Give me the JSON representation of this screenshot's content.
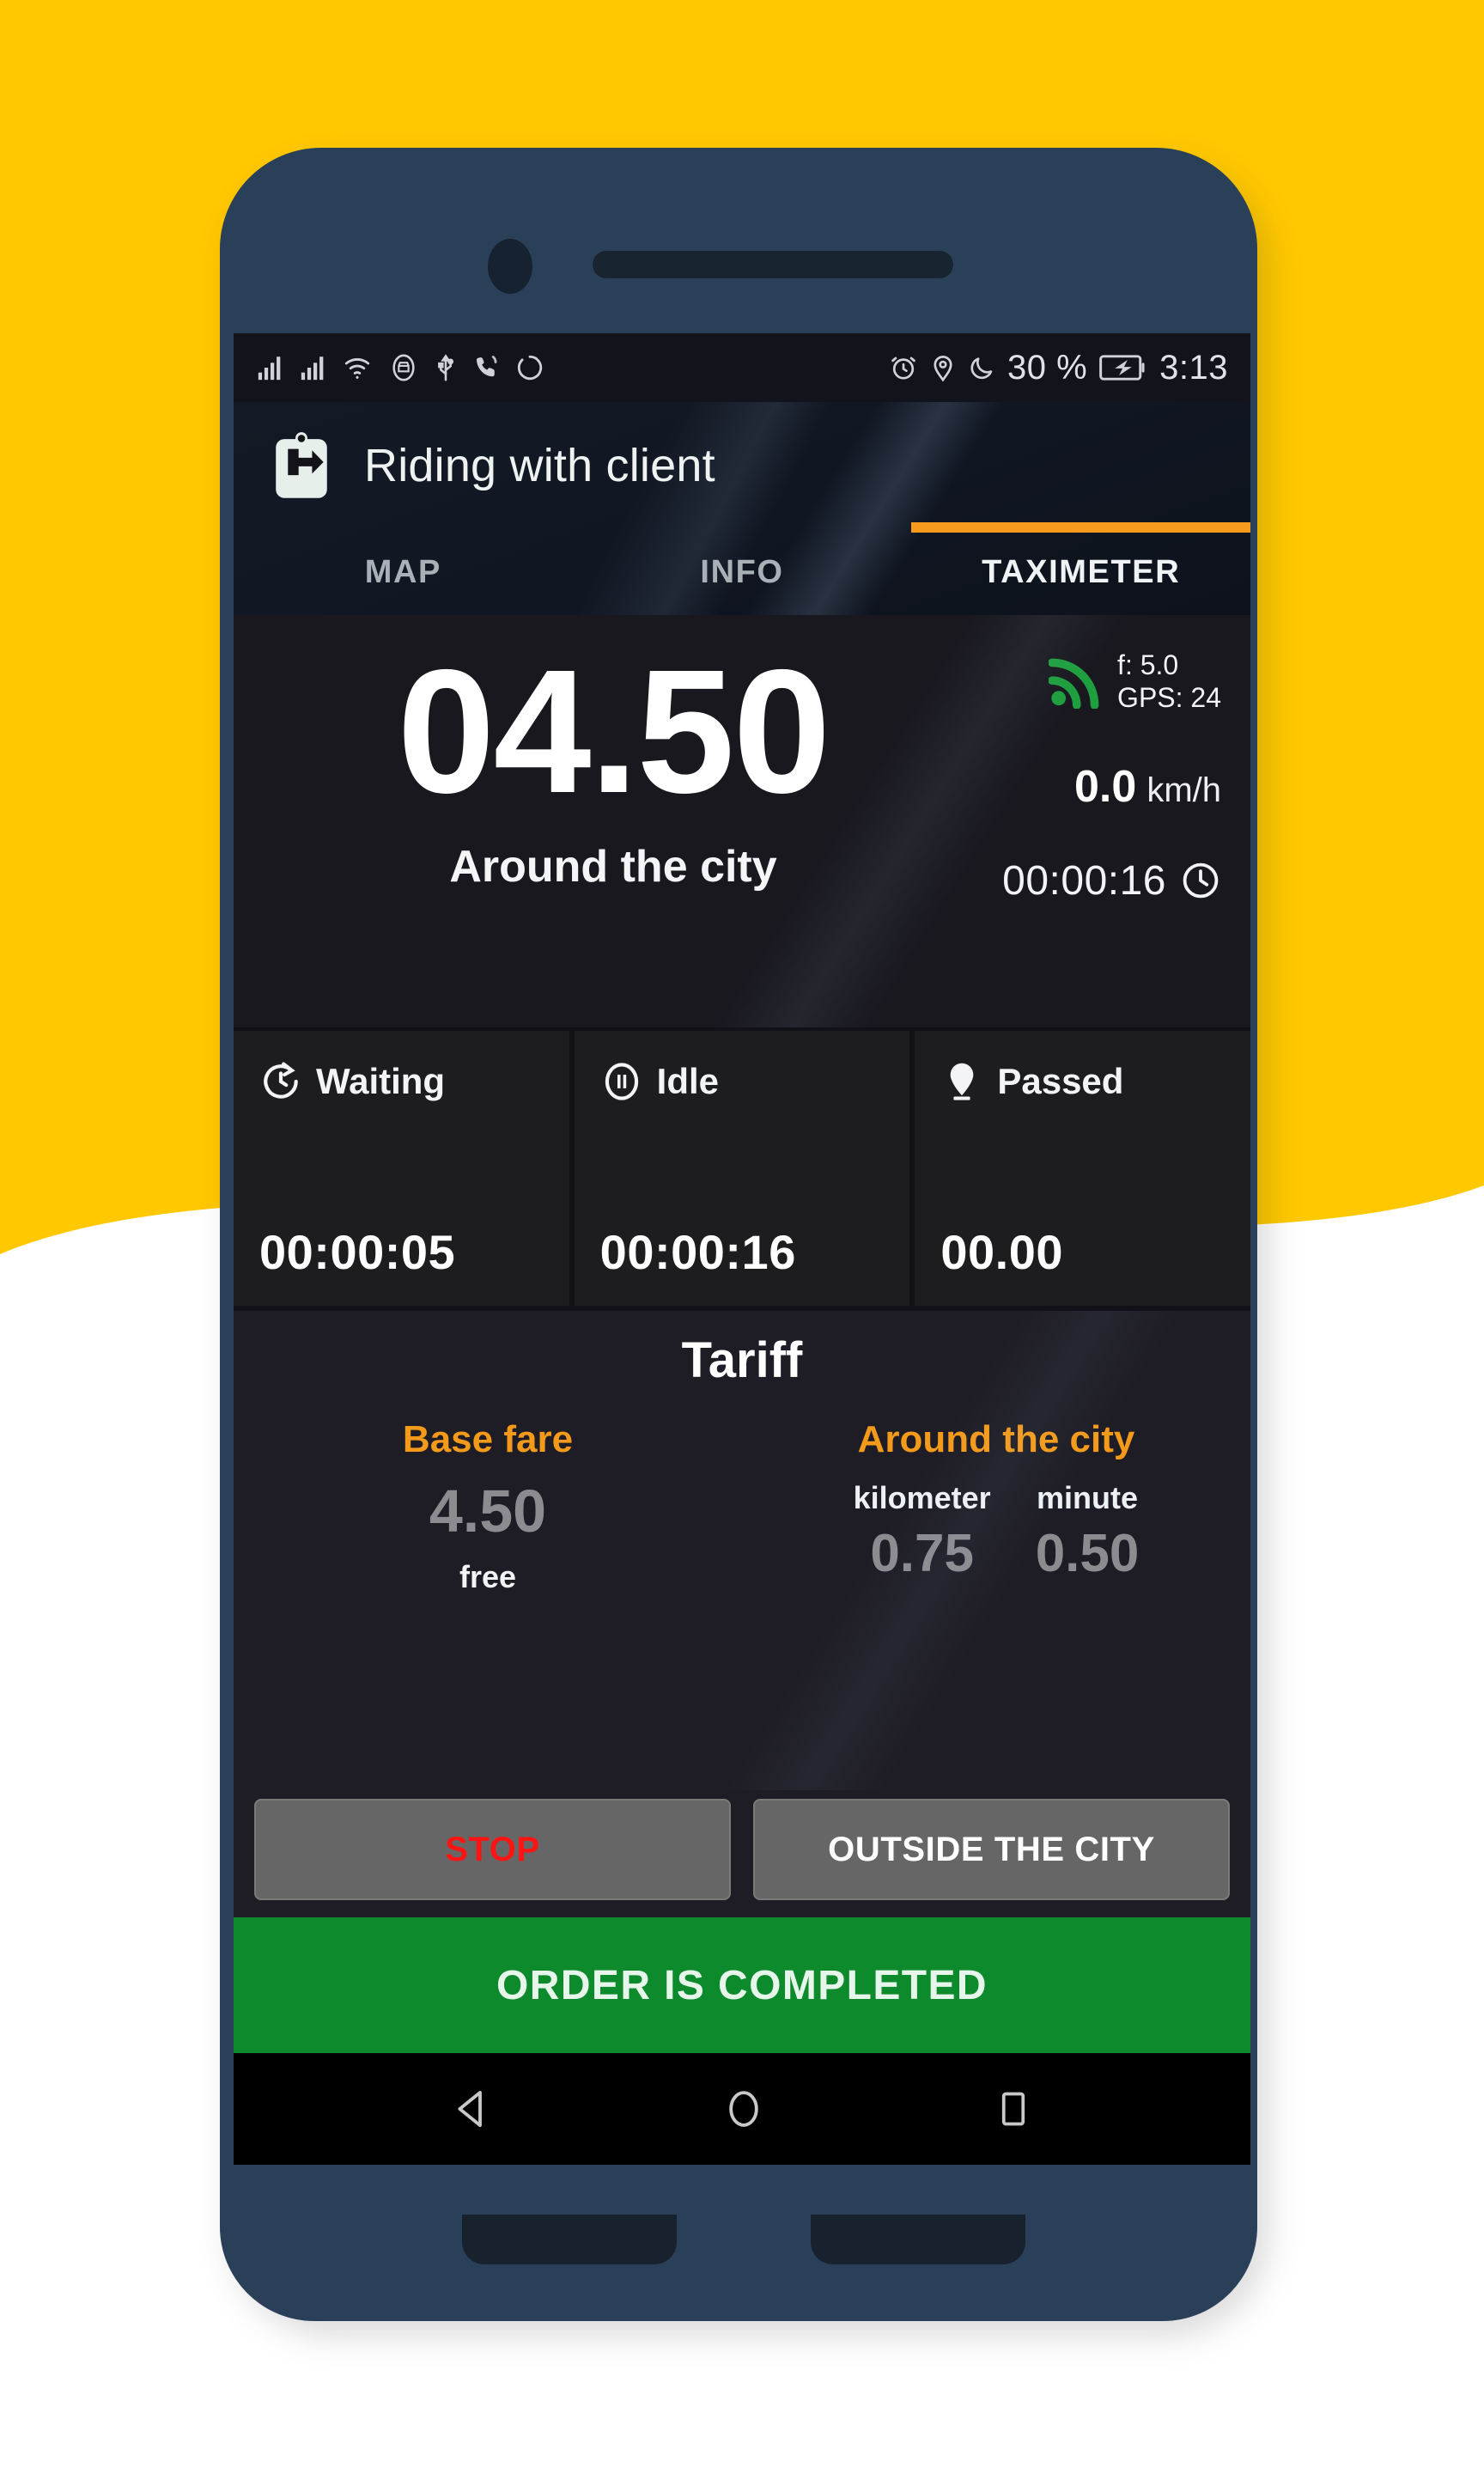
{
  "background": {
    "accent_color": "#FFC800",
    "base_color": "#FFFFFF"
  },
  "device": {
    "frame_color": "#2A4059"
  },
  "status_bar": {
    "icons_left": [
      "signal-bars-icon",
      "signal-bars-icon",
      "wifi-icon",
      "car-mode-icon",
      "usb-icon",
      "call-vibrate-icon",
      "sync-icon"
    ],
    "icons_right": [
      "alarm-icon",
      "location-icon",
      "do-not-disturb-moon-icon",
      "battery-charging-icon"
    ],
    "battery": "30 %",
    "clock": "3:13"
  },
  "header": {
    "status_icon": "ride-tag-arrow-icon",
    "title": "Riding with client",
    "tabs": [
      {
        "label": "MAP",
        "active": false
      },
      {
        "label": "INFO",
        "active": false
      },
      {
        "label": "TAXIMETER",
        "active": true
      }
    ],
    "active_indicator_color": "#F89A1C"
  },
  "meter": {
    "fare_amount": "04.50",
    "tariff_name": "Around the city",
    "gps_icon": "gps-signal-icon",
    "gps_icon_color": "#1E9E3E",
    "accuracy": "f: 5.0",
    "satellites": "GPS: 24",
    "speed_value": "0.0",
    "speed_unit": "km/h",
    "elapsed": "00:00:16",
    "elapsed_icon": "clock-icon"
  },
  "stats": [
    {
      "icon": "waiting-clock-arrow-icon",
      "label": "Waiting",
      "value": "00:00:05"
    },
    {
      "icon": "pause-circle-icon",
      "label": "Idle",
      "value": "00:00:16"
    },
    {
      "icon": "map-pin-icon",
      "label": "Passed",
      "value": "00.00"
    }
  ],
  "tariff": {
    "title": "Tariff",
    "accent_color": "#F49A1B",
    "base": {
      "head": "Base fare",
      "amount": "4.50",
      "note": "free"
    },
    "zone": {
      "head": "Around the city",
      "rates": [
        {
          "name": "kilometer",
          "value": "0.75"
        },
        {
          "name": "minute",
          "value": "0.50"
        }
      ]
    }
  },
  "actions": {
    "stop_label": "STOP",
    "stop_color": "#FF1414",
    "outside_label": "OUTSIDE THE CITY"
  },
  "order_complete": {
    "label": "ORDER IS COMPLETED",
    "color": "#0D8A2B"
  },
  "navbar": {
    "back": "back-triangle-icon",
    "home": "home-circle-icon",
    "recents": "recents-square-icon"
  }
}
